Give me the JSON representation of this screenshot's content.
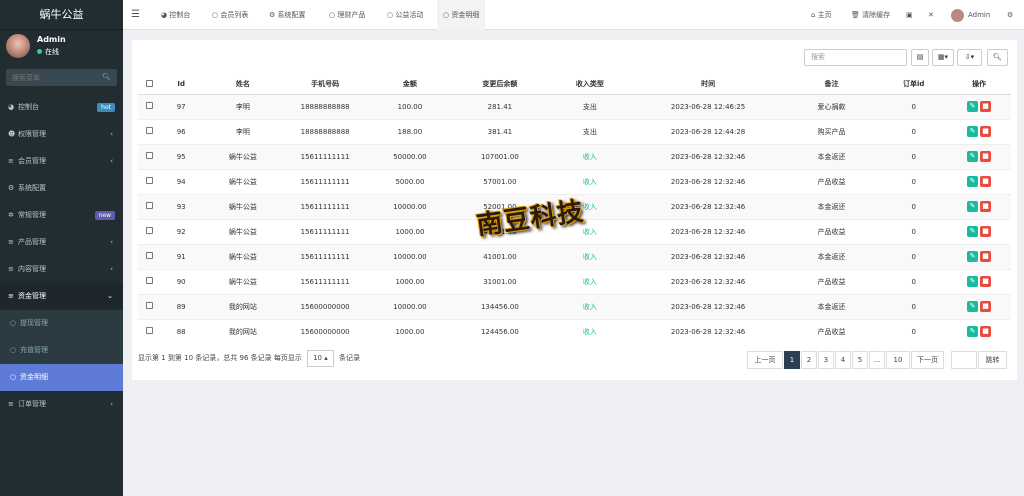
{
  "brand": "蜗牛公益",
  "user": {
    "name": "Admin",
    "status": "在线"
  },
  "sidebar_search": {
    "placeholder": "搜索菜单"
  },
  "menu": [
    {
      "label": "控制台",
      "icon": "dashboard-icon",
      "badge": "hot",
      "badge_color": "#3c8dbc"
    },
    {
      "label": "权限管理",
      "icon": "users-icon",
      "arrow": "‹"
    },
    {
      "label": "会员管理",
      "icon": "list-icon",
      "arrow": "‹"
    },
    {
      "label": "系统配置",
      "icon": "gear-icon"
    },
    {
      "label": "常规管理",
      "icon": "cogs-icon",
      "badge": "new",
      "badge_color": "#605ca8"
    },
    {
      "label": "产品管理",
      "icon": "list-icon",
      "arrow": "‹"
    },
    {
      "label": "内容管理",
      "icon": "list-icon",
      "arrow": "‹"
    },
    {
      "label": "资金管理",
      "icon": "list-icon",
      "arrow": "⌄",
      "open": true
    }
  ],
  "submenu": [
    {
      "label": "提现管理"
    },
    {
      "label": "充值管理"
    },
    {
      "label": "资金明细",
      "active": true
    }
  ],
  "menu_after": [
    {
      "label": "订单管理",
      "icon": "list-icon",
      "arrow": "‹"
    }
  ],
  "topbar": {
    "tabs": [
      {
        "label": "控制台",
        "icon": "dashboard-icon"
      },
      {
        "label": "会员列表",
        "icon": "circle-icon"
      },
      {
        "label": "系统配置",
        "icon": "gear-icon"
      },
      {
        "label": "理财产品",
        "icon": "circle-icon"
      },
      {
        "label": "公益活动",
        "icon": "circle-icon"
      },
      {
        "label": "资金明细",
        "icon": "circle-icon",
        "active": true
      }
    ],
    "home": "主页",
    "clear_cache": "清除缓存",
    "admin": "Admin"
  },
  "toolbar": {
    "search_placeholder": "搜索"
  },
  "table": {
    "headers": [
      "Id",
      "姓名",
      "手机号码",
      "金额",
      "变更后余额",
      "收入类型",
      "时间",
      "备注",
      "订单id",
      "操作"
    ],
    "rows": [
      [
        "97",
        "李明",
        "18888888888",
        "100.00",
        "281.41",
        "支出",
        "2023-06-28 12:46:25",
        "爱心捐款",
        "0"
      ],
      [
        "96",
        "李明",
        "18888888888",
        "188.00",
        "381.41",
        "支出",
        "2023-06-28 12:44:28",
        "购买产品",
        "0"
      ],
      [
        "95",
        "蜗牛公益",
        "15611111111",
        "50000.00",
        "107001.00",
        "收入",
        "2023-06-28 12:32:46",
        "本金返还",
        "0"
      ],
      [
        "94",
        "蜗牛公益",
        "15611111111",
        "5000.00",
        "57001.00",
        "收入",
        "2023-06-28 12:32:46",
        "产品收益",
        "0"
      ],
      [
        "93",
        "蜗牛公益",
        "15611111111",
        "10000.00",
        "52001.00",
        "收入",
        "2023-06-28 12:32:46",
        "本金返还",
        "0"
      ],
      [
        "92",
        "蜗牛公益",
        "15611111111",
        "1000.00",
        "42001.00",
        "收入",
        "2023-06-28 12:32:46",
        "产品收益",
        "0"
      ],
      [
        "91",
        "蜗牛公益",
        "15611111111",
        "10000.00",
        "41001.00",
        "收入",
        "2023-06-28 12:32:46",
        "本金返还",
        "0"
      ],
      [
        "90",
        "蜗牛公益",
        "15611111111",
        "1000.00",
        "31001.00",
        "收入",
        "2023-06-28 12:32:46",
        "产品收益",
        "0"
      ],
      [
        "89",
        "我的网站",
        "15600000000",
        "10000.00",
        "134456.00",
        "收入",
        "2023-06-28 12:32:46",
        "本金返还",
        "0"
      ],
      [
        "88",
        "我的网站",
        "15600000000",
        "1000.00",
        "124456.00",
        "收入",
        "2023-06-28 12:32:46",
        "产品收益",
        "0"
      ]
    ]
  },
  "footer": {
    "summary": "显示第 1 到第 10 条记录，总共 96 条记录 每页显示",
    "page_size": "10",
    "suffix": "条记录"
  },
  "pagination": {
    "prev": "上一页",
    "pages": [
      "1",
      "2",
      "3",
      "4",
      "5",
      "...",
      "10"
    ],
    "next": "下一页",
    "jump": "跳转"
  },
  "watermark": "南豆科技"
}
